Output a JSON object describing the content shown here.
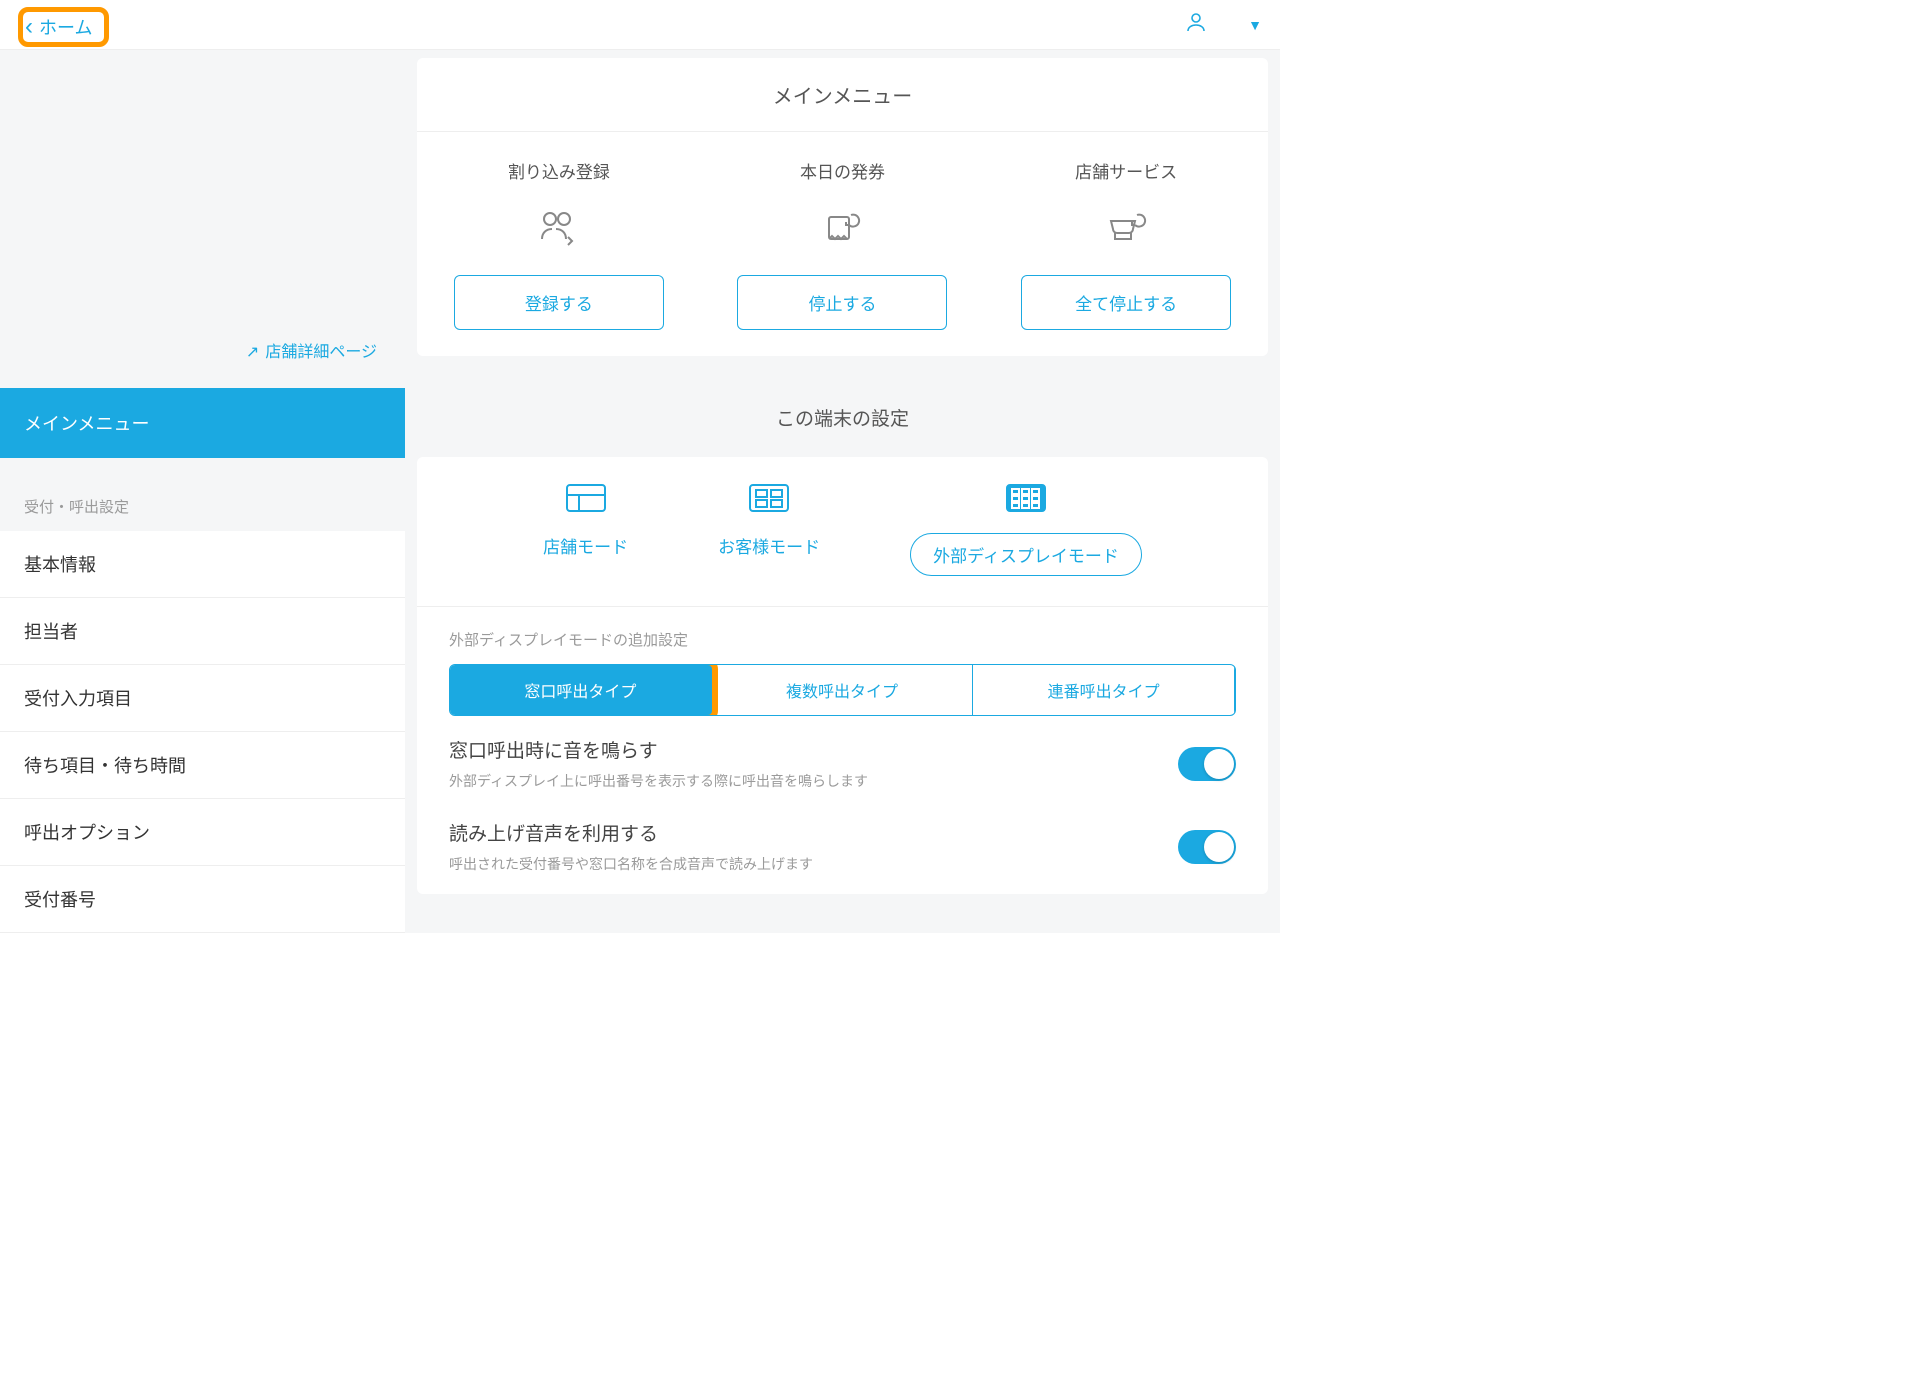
{
  "header": {
    "back_label": "ホーム"
  },
  "sidebar": {
    "store_link": "店舗詳細ページ",
    "active_item": "メインメニュー",
    "section_label": "受付・呼出設定",
    "items": [
      "基本情報",
      "担当者",
      "受付入力項目",
      "待ち項目・待ち時間",
      "呼出オプション",
      "受付番号"
    ]
  },
  "main_menu": {
    "title": "メインメニュー",
    "cols": [
      {
        "title": "割り込み登録",
        "button": "登録する"
      },
      {
        "title": "本日の発券",
        "button": "停止する"
      },
      {
        "title": "店舗サービス",
        "button": "全て停止する"
      }
    ]
  },
  "device": {
    "section_title": "この端末の設定",
    "modes": [
      "店舗モード",
      "お客様モード",
      "外部ディスプレイモード"
    ],
    "subtitle": "外部ディスプレイモードの追加設定",
    "segments": [
      "窓口呼出タイプ",
      "複数呼出タイプ",
      "連番呼出タイプ"
    ],
    "settings": [
      {
        "title": "窓口呼出時に音を鳴らす",
        "desc": "外部ディスプレイ上に呼出番号を表示する際に呼出音を鳴らします"
      },
      {
        "title": "読み上げ音声を利用する",
        "desc": "呼出された受付番号や窓口名称を合成音声で読み上げます"
      }
    ]
  }
}
